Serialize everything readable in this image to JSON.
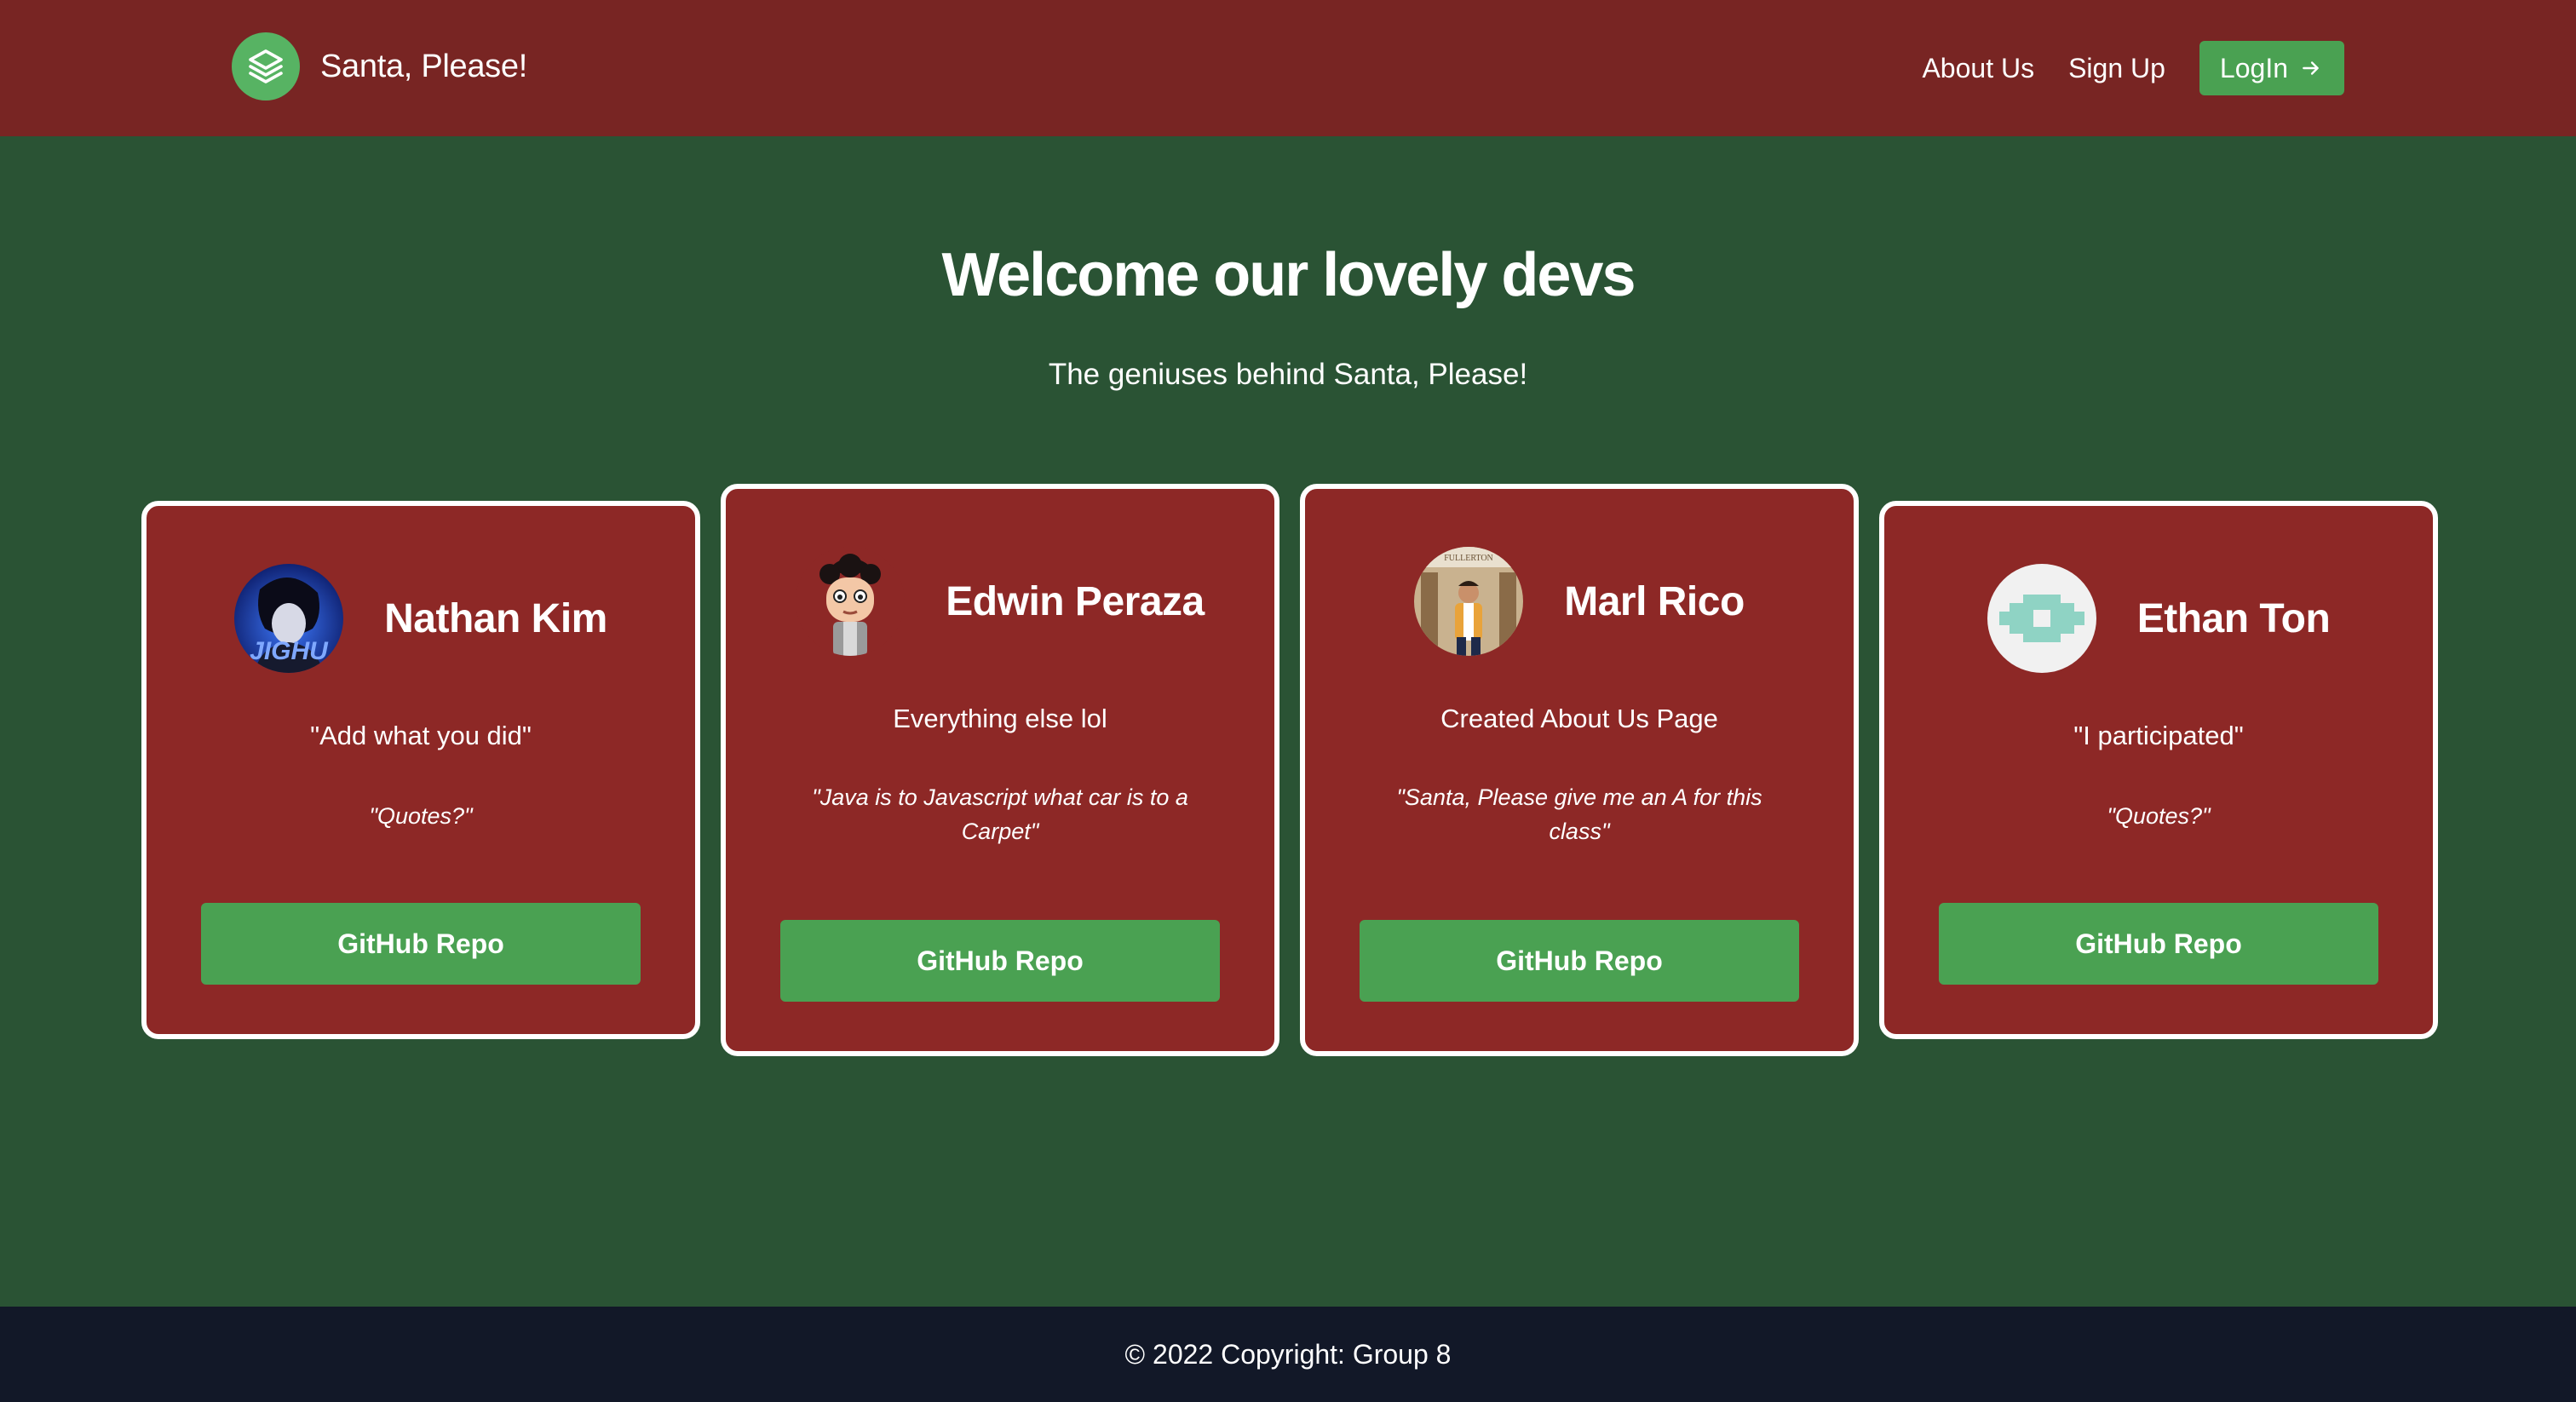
{
  "header": {
    "brand_name": "Santa, Please!",
    "brand_icon": "layers-icon",
    "nav": {
      "about": "About Us",
      "signup": "Sign Up",
      "login": "LogIn"
    },
    "login_icon": "arrow-right-icon"
  },
  "hero": {
    "title": "Welcome our lovely devs",
    "subtitle": "The geniuses behind Santa, Please!"
  },
  "devs": [
    {
      "name": "Nathan Kim",
      "role": "\"Add what you did\"",
      "quote": "\"Quotes?\"",
      "button": "GitHub Repo",
      "avatar_text": "JIGHU"
    },
    {
      "name": "Edwin Peraza",
      "role": "Everything else lol",
      "quote": "\"Java is to Javascript what car is to a Carpet\"",
      "button": "GitHub Repo"
    },
    {
      "name": "Marl Rico",
      "role": "Created About Us Page",
      "quote": "\"Santa, Please give me an A for this class\"",
      "button": "GitHub Repo",
      "avatar_text": "FULLERTON"
    },
    {
      "name": "Ethan Ton",
      "role": "\"I participated\"",
      "quote": "\"Quotes?\"",
      "button": "GitHub Repo"
    }
  ],
  "footer": {
    "copyright": "© 2022 Copyright: Group 8"
  },
  "colors": {
    "header_bg": "#782523",
    "page_bg": "#2a5334",
    "card_bg": "#8d2826",
    "accent_green": "#4aa152",
    "footer_bg": "#121828"
  }
}
